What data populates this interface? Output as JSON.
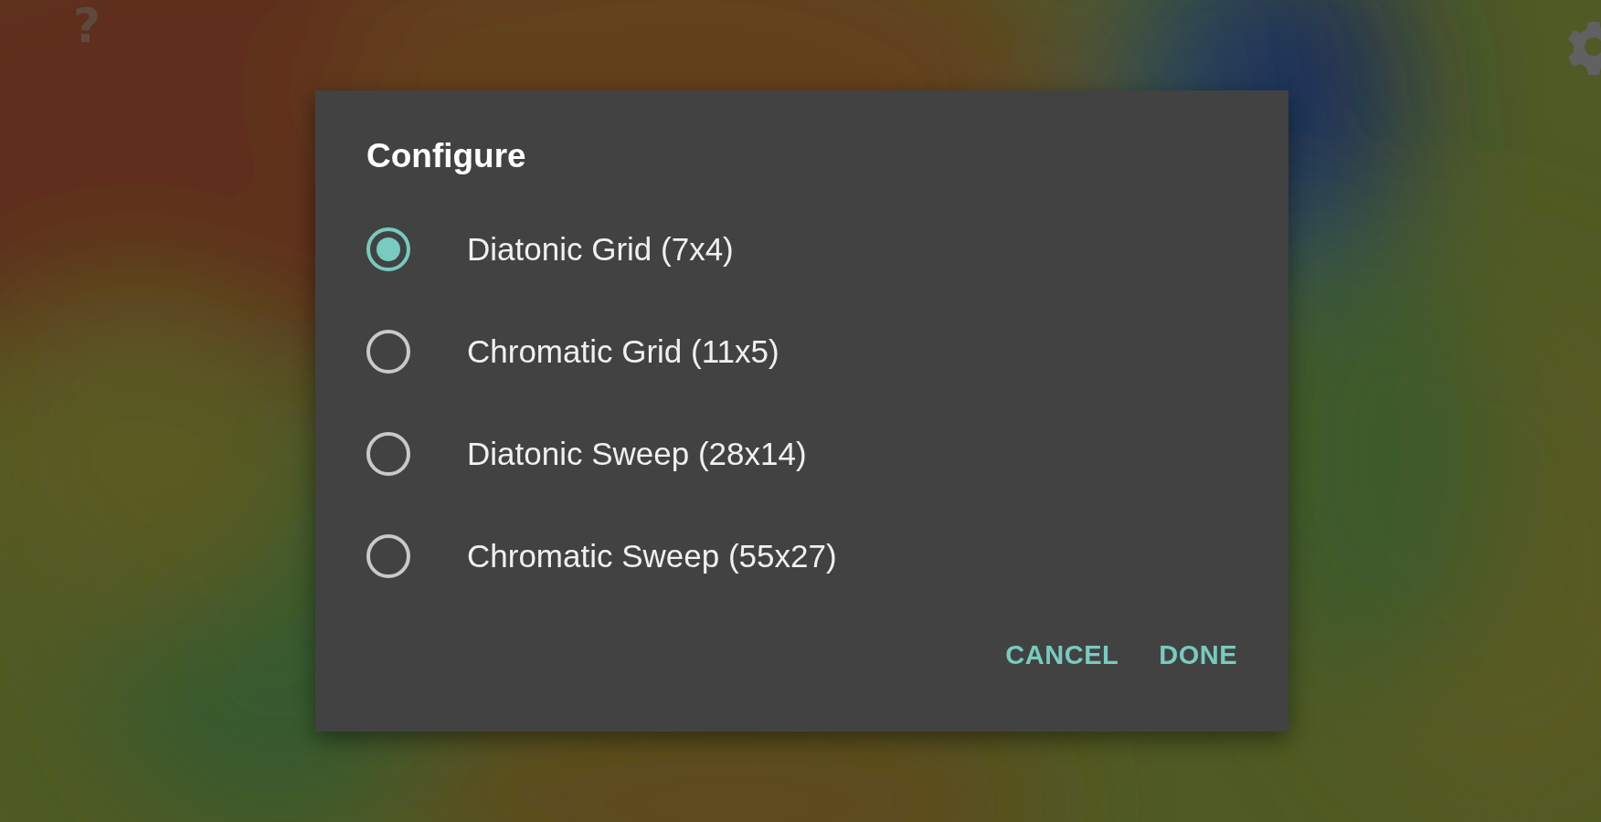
{
  "help_label": "?",
  "dialog": {
    "title": "Configure",
    "options": [
      {
        "label": "Diatonic Grid (7x4)",
        "selected": true
      },
      {
        "label": "Chromatic Grid (11x5)",
        "selected": false
      },
      {
        "label": "Diatonic Sweep (28x14)",
        "selected": false
      },
      {
        "label": "Chromatic Sweep (55x27)",
        "selected": false
      }
    ],
    "buttons": [
      "CANCEL",
      "DONE"
    ]
  }
}
